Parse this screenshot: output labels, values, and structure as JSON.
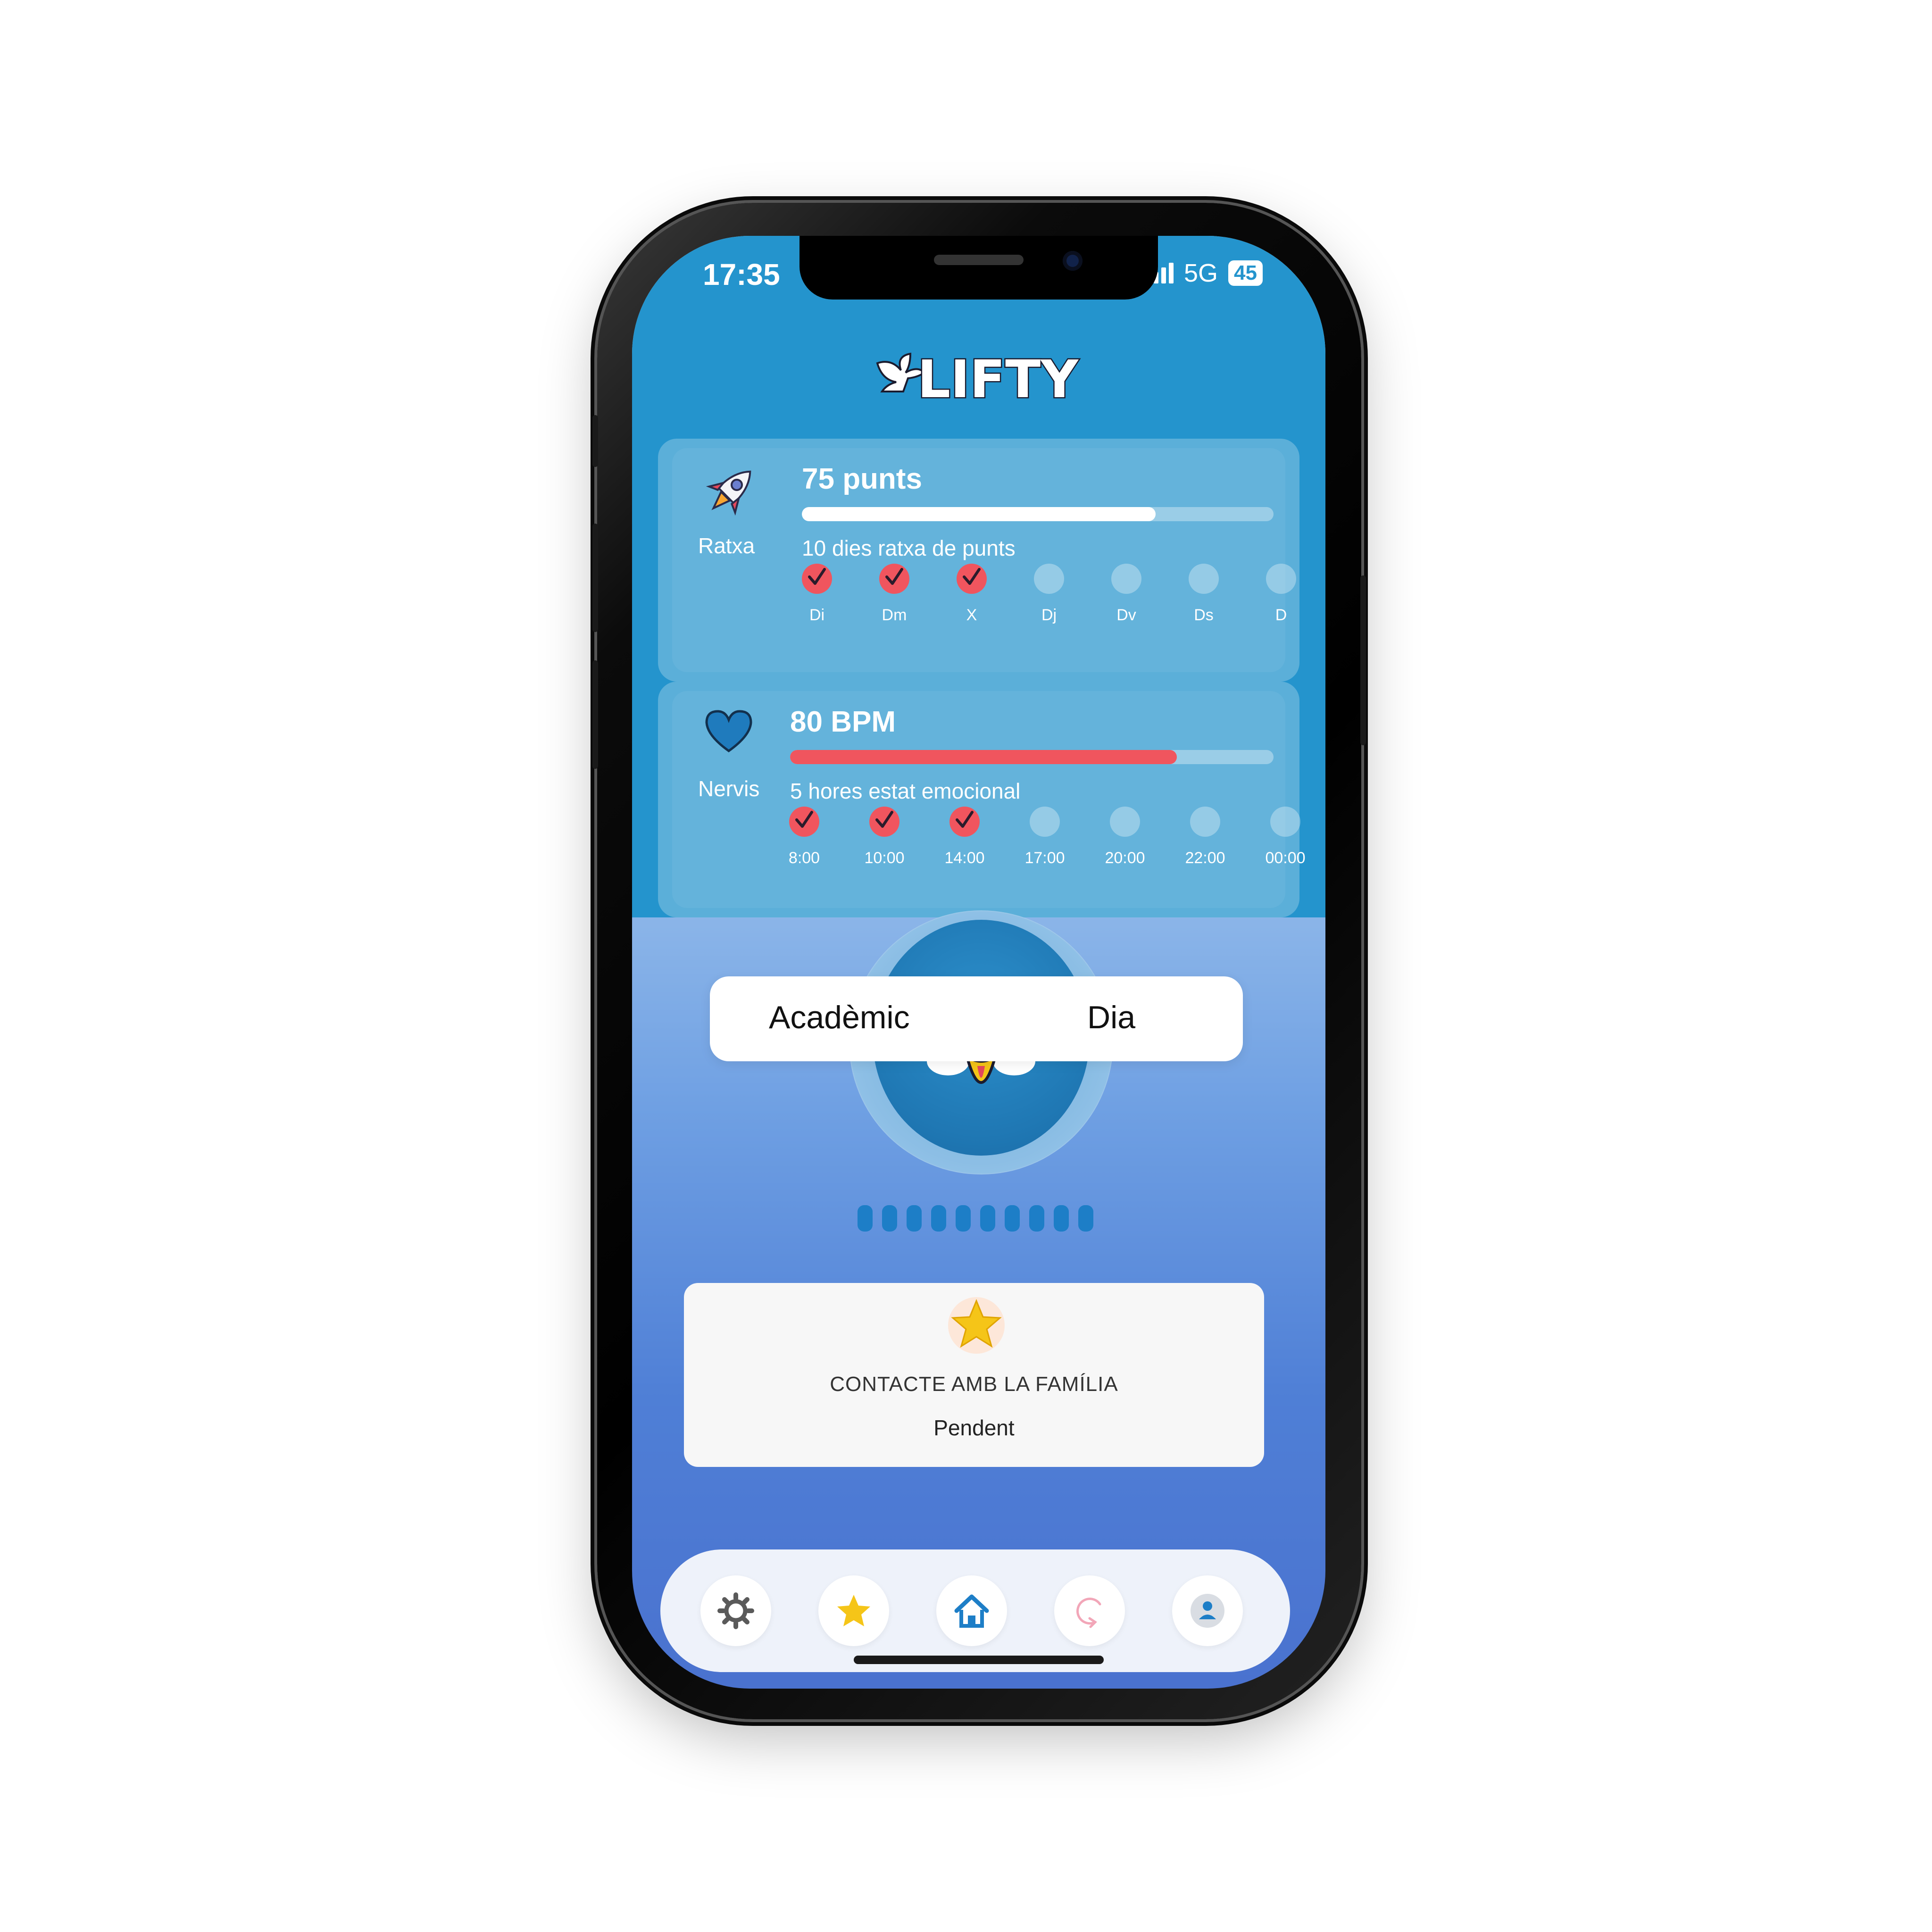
{
  "status_bar": {
    "time": "17:35",
    "network": "5G",
    "battery": "45"
  },
  "app": {
    "logo_text": "LIFTY"
  },
  "streak_card": {
    "caption": "Ratxa",
    "value_label": "75 punts",
    "progress": 0.75,
    "subtitle": "10 dies ratxa de punts",
    "days": [
      {
        "label": "Di",
        "done": true
      },
      {
        "label": "Dm",
        "done": true
      },
      {
        "label": "X",
        "done": true
      },
      {
        "label": "Dj",
        "done": false
      },
      {
        "label": "Dv",
        "done": false
      },
      {
        "label": "Ds",
        "done": false
      },
      {
        "label": "D",
        "done": false
      }
    ]
  },
  "nerves_card": {
    "caption": "Nervis",
    "value_label": "80 BPM",
    "progress": 0.8,
    "subtitle": "5 hores estat emocional",
    "hours": [
      {
        "label": "8:00",
        "done": true
      },
      {
        "label": "10:00",
        "done": true
      },
      {
        "label": "14:00",
        "done": true
      },
      {
        "label": "17:00",
        "done": false
      },
      {
        "label": "20:00",
        "done": false
      },
      {
        "label": "22:00",
        "done": false
      },
      {
        "label": "00:00",
        "done": false
      }
    ]
  },
  "selector": {
    "left_label": "Acadèmic",
    "right_label": "Dia"
  },
  "pager": {
    "count": 10
  },
  "task": {
    "title": "CONTACTE AMB LA FAMÍLIA",
    "status": "Pendent"
  },
  "tabbar": {
    "items": [
      "gear-icon",
      "star-icon",
      "home-icon",
      "refresh-icon",
      "user-icon"
    ],
    "active": "home-icon"
  },
  "colors": {
    "header": "#2494cd",
    "accent_red": "#f0555e",
    "tab_blue": "#1d7ec7",
    "star": "#f5c518"
  }
}
